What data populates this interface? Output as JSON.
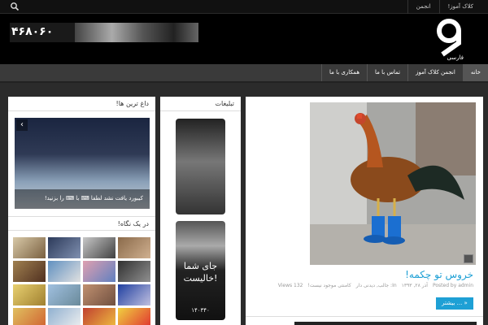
{
  "topbar": {
    "links": [
      "کلاک آموز!",
      "انجمن"
    ]
  },
  "header": {
    "banner_number": "۴۶۸۰۶۰",
    "logo_text": "فارسی"
  },
  "nav": {
    "items": [
      "خانه",
      "انجمن کلاک آموز",
      "تماس با ما",
      "همکاری با ما"
    ]
  },
  "post": {
    "title": "خروس تو چکمه!",
    "meta": [
      "Posted by admin",
      "آذر ۲۸, ۱۳۹۳",
      "In: جالب, دیدنی دار",
      "کامنتی موجود نیست!",
      "Views 132"
    ],
    "more_label": "بیشتر ... »"
  },
  "ads": {
    "heading": "تبلیغات",
    "ad2_text_line1": "جای شما",
    "ad2_text_line2": "خالیست!",
    "ad2_number": "۱۴۰۳۴۰"
  },
  "left": {
    "heading1": "داغ ترین ها!",
    "slide_caption": "کیبورد یافت نشد لطفا ⌨ با ⌨ را بزنید!",
    "heading2": "در یک نگاه!"
  },
  "colors": {
    "accent": "#1ea0d5"
  },
  "icons": {
    "search": "search-icon",
    "photo": "photo-icon",
    "slider_prev": "chevron-left-icon"
  }
}
